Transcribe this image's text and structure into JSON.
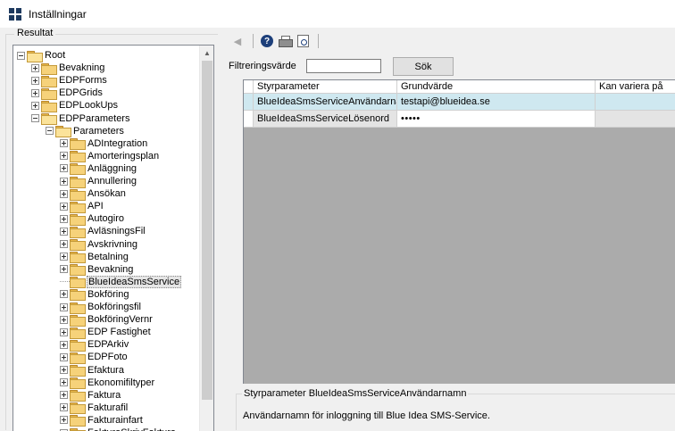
{
  "window": {
    "title": "Inställningar"
  },
  "left_panel": {
    "group_label": "Resultat",
    "tree": [
      {
        "label": "Root",
        "level": 0,
        "expander": "minus",
        "open": true
      },
      {
        "label": "Bevakning",
        "level": 1,
        "expander": "plus",
        "open": false
      },
      {
        "label": "EDPForms",
        "level": 1,
        "expander": "plus",
        "open": false
      },
      {
        "label": "EDPGrids",
        "level": 1,
        "expander": "plus",
        "open": false
      },
      {
        "label": "EDPLookUps",
        "level": 1,
        "expander": "plus",
        "open": false
      },
      {
        "label": "EDPParameters",
        "level": 1,
        "expander": "minus",
        "open": true
      },
      {
        "label": "Parameters",
        "level": 2,
        "expander": "minus",
        "open": true
      },
      {
        "label": "ADIntegration",
        "level": 3,
        "expander": "plus",
        "open": false
      },
      {
        "label": "Amorteringsplan",
        "level": 3,
        "expander": "plus",
        "open": false
      },
      {
        "label": "Anläggning",
        "level": 3,
        "expander": "plus",
        "open": false
      },
      {
        "label": "Annullering",
        "level": 3,
        "expander": "plus",
        "open": false
      },
      {
        "label": "Ansökan",
        "level": 3,
        "expander": "plus",
        "open": false
      },
      {
        "label": "API",
        "level": 3,
        "expander": "plus",
        "open": false
      },
      {
        "label": "Autogiro",
        "level": 3,
        "expander": "plus",
        "open": false
      },
      {
        "label": "AvläsningsFil",
        "level": 3,
        "expander": "plus",
        "open": false
      },
      {
        "label": "Avskrivning",
        "level": 3,
        "expander": "plus",
        "open": false
      },
      {
        "label": "Betalning",
        "level": 3,
        "expander": "plus",
        "open": false
      },
      {
        "label": "Bevakning",
        "level": 3,
        "expander": "plus",
        "open": false
      },
      {
        "label": "BlueIdeaSmsService",
        "level": 3,
        "expander": "none",
        "open": false,
        "selected": true
      },
      {
        "label": "Bokföring",
        "level": 3,
        "expander": "plus",
        "open": false
      },
      {
        "label": "Bokföringsfil",
        "level": 3,
        "expander": "plus",
        "open": false
      },
      {
        "label": "BokföringVernr",
        "level": 3,
        "expander": "plus",
        "open": false
      },
      {
        "label": "EDP Fastighet",
        "level": 3,
        "expander": "plus",
        "open": false
      },
      {
        "label": "EDPArkiv",
        "level": 3,
        "expander": "plus",
        "open": false
      },
      {
        "label": "EDPFoto",
        "level": 3,
        "expander": "plus",
        "open": false
      },
      {
        "label": "Efaktura",
        "level": 3,
        "expander": "plus",
        "open": false
      },
      {
        "label": "Ekonomifiltyper",
        "level": 3,
        "expander": "plus",
        "open": false
      },
      {
        "label": "Faktura",
        "level": 3,
        "expander": "plus",
        "open": false
      },
      {
        "label": "Fakturafil",
        "level": 3,
        "expander": "plus",
        "open": false
      },
      {
        "label": "Fakturainfart",
        "level": 3,
        "expander": "plus",
        "open": false
      },
      {
        "label": "FakturaSkrivFaktura",
        "level": 3,
        "expander": "plus",
        "open": false
      }
    ]
  },
  "toolbar": {
    "icons": [
      "back-arrow-icon",
      "help-icon",
      "print-icon",
      "print-preview-icon"
    ]
  },
  "filter": {
    "label": "Filtreringsvärde",
    "value": "",
    "search_button": "Sök"
  },
  "grid": {
    "columns": [
      "Styrparameter",
      "Grundvärde",
      "Kan variera på"
    ],
    "rows": [
      {
        "styrparameter": "BlueIdeaSmsServiceAnvändarnamn",
        "grundvarde": "testapi@blueidea.se",
        "kan_variera": "",
        "selected": true
      },
      {
        "styrparameter": "BlueIdeaSmsServiceLösenord",
        "grundvarde": "•••••",
        "kan_variera": "",
        "selected": false
      }
    ]
  },
  "description": {
    "title": "Styrparameter BlueIdeaSmsServiceAnvändarnamn",
    "text": "Användarnamn för inloggning till Blue Idea SMS-Service."
  }
}
